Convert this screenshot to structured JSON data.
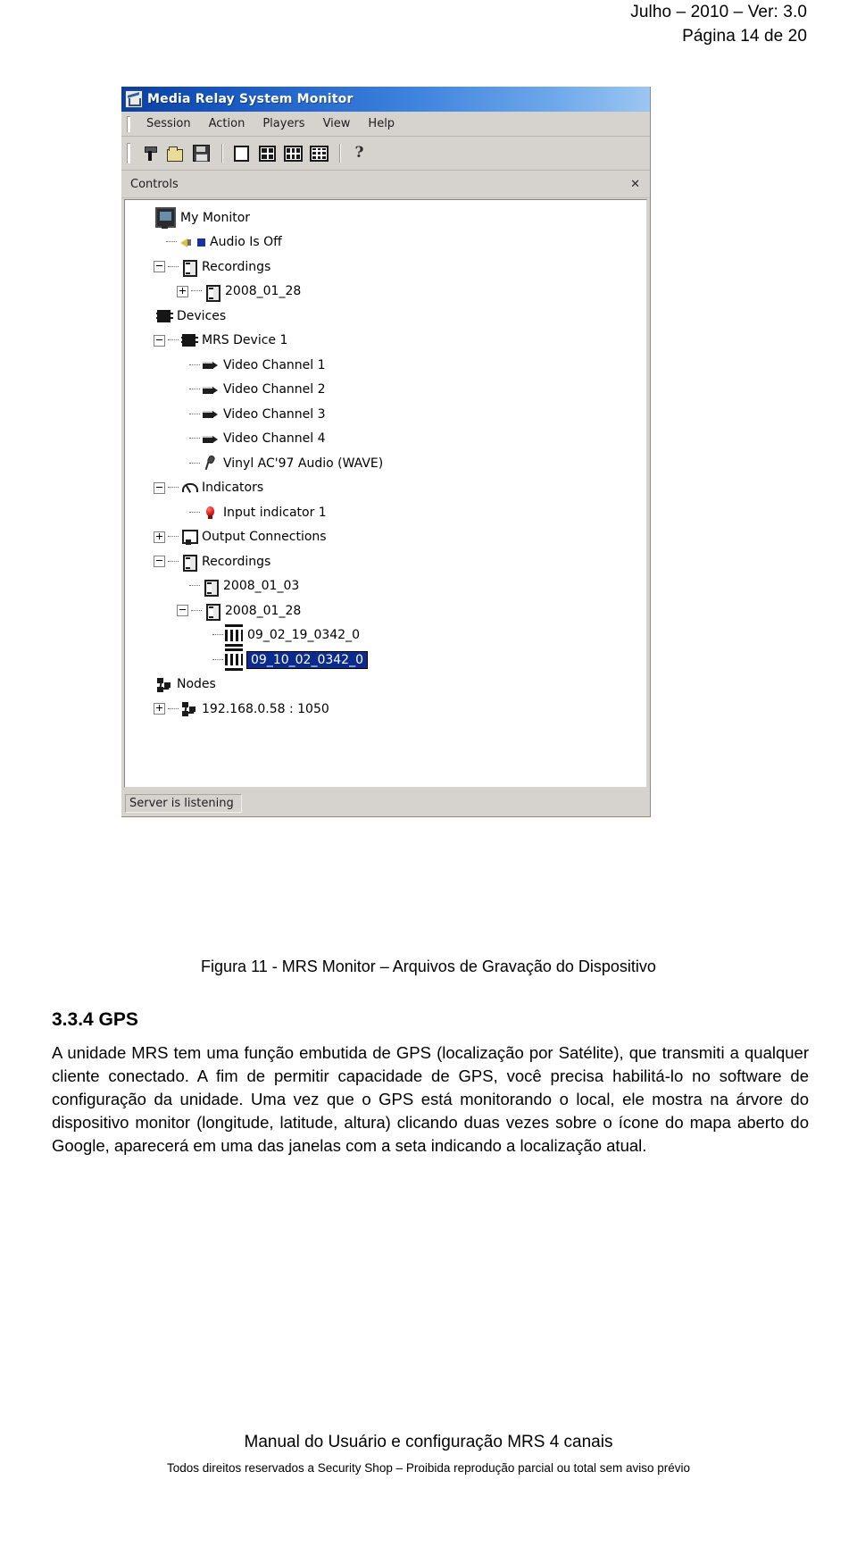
{
  "page_header": {
    "line1": "Julho – 2010 – Ver: 3.0",
    "line2": "Página 14 de 20"
  },
  "app_window": {
    "title": "Media Relay System Monitor",
    "title_icon": "app-logo-icon",
    "menu": [
      {
        "label": "Session"
      },
      {
        "label": "Action"
      },
      {
        "label": "Players"
      },
      {
        "label": "View"
      },
      {
        "label": "Help"
      }
    ],
    "toolbar": [
      {
        "icon": "connect-icon",
        "name": "new-session-button"
      },
      {
        "icon": "open-folder-icon",
        "name": "open-button"
      },
      {
        "icon": "save-floppy-icon",
        "name": "save-button"
      },
      {
        "icon": "separator",
        "name": "toolbar-separator-1"
      },
      {
        "icon": "layout-1x1-icon",
        "name": "layout-single-button"
      },
      {
        "icon": "layout-2x2-icon",
        "name": "layout-quad-button"
      },
      {
        "icon": "layout-2x3-icon",
        "name": "layout-six-button"
      },
      {
        "icon": "layout-3x3-icon",
        "name": "layout-nine-button"
      },
      {
        "icon": "separator",
        "name": "toolbar-separator-2"
      },
      {
        "icon": "help-question-icon",
        "name": "help-button"
      }
    ],
    "panel": {
      "caption": "Controls",
      "close_label": "✕"
    },
    "tree": [
      {
        "label": "My Monitor",
        "icon": "monitor-icon",
        "indent": 0,
        "expander": "none",
        "selected": false
      },
      {
        "label": "Audio Is Off",
        "icon": "speaker-icon",
        "indent": 1,
        "expander": "none",
        "selected": false,
        "badge": "blue-square"
      },
      {
        "label": "Recordings",
        "icon": "recordings-icon",
        "indent": 1,
        "expander": "minus",
        "selected": false
      },
      {
        "label": "2008_01_28",
        "icon": "recording-day-icon",
        "indent": 2,
        "expander": "plus",
        "selected": false
      },
      {
        "label": "Devices",
        "icon": "chip-icon",
        "indent": 0,
        "expander": "none",
        "selected": false
      },
      {
        "label": "MRS Device 1",
        "icon": "chip-icon",
        "indent": 1,
        "expander": "minus",
        "selected": false
      },
      {
        "label": "Video Channel 1",
        "icon": "camera-icon",
        "indent": 2,
        "expander": "none",
        "selected": false
      },
      {
        "label": "Video Channel 2",
        "icon": "camera-icon",
        "indent": 2,
        "expander": "none",
        "selected": false
      },
      {
        "label": "Video Channel 3",
        "icon": "camera-icon",
        "indent": 2,
        "expander": "none",
        "selected": false
      },
      {
        "label": "Video Channel 4",
        "icon": "camera-icon",
        "indent": 2,
        "expander": "none",
        "selected": false
      },
      {
        "label": "Vinyl AC'97 Audio (WAVE)",
        "icon": "microphone-icon",
        "indent": 2,
        "expander": "none",
        "selected": false
      },
      {
        "label": "Indicators",
        "icon": "gauge-icon",
        "indent": 1,
        "expander": "minus",
        "selected": false
      },
      {
        "label": "Input indicator 1",
        "icon": "led-indicator-icon",
        "indent": 2,
        "expander": "none",
        "selected": false
      },
      {
        "label": "Output Connections",
        "icon": "output-icon",
        "indent": 1,
        "expander": "plus",
        "selected": false
      },
      {
        "label": "Recordings",
        "icon": "recordings-icon",
        "indent": 1,
        "expander": "minus",
        "selected": false
      },
      {
        "label": "2008_01_03",
        "icon": "recording-day-icon",
        "indent": 2,
        "expander": "none",
        "selected": false
      },
      {
        "label": "2008_01_28",
        "icon": "recording-day-icon",
        "indent": 2,
        "expander": "minus",
        "selected": false
      },
      {
        "label": "09_02_19_0342_0",
        "icon": "film-strip-icon",
        "indent": 3,
        "expander": "none",
        "selected": false
      },
      {
        "label": "09_10_02_0342_0",
        "icon": "film-strip-icon",
        "indent": 3,
        "expander": "none",
        "selected": true
      },
      {
        "label": "Nodes",
        "icon": "network-node-icon",
        "indent": 0,
        "expander": "none",
        "selected": false
      },
      {
        "label": "192.168.0.58 : 1050",
        "icon": "network-node-icon",
        "indent": 1,
        "expander": "plus",
        "selected": false
      }
    ],
    "statusbar": {
      "text": "Server is listening"
    },
    "colors": {
      "selection": "#0b2c8c",
      "titlebar_start": "#0b3fa0",
      "titlebar_end": "#9cc6f2",
      "chrome": "#d6d3ce",
      "led_red": "#d81414"
    }
  },
  "figure_caption": "Figura 11 - MRS Monitor – Arquivos de Gravação do Dispositivo",
  "section": {
    "heading": "3.3.4 GPS",
    "body": "A unidade MRS tem uma função embutida de GPS (localização por Satélite), que transmiti a qualquer cliente conectado. A fim de permitir capacidade de GPS, você precisa habilitá-lo no software de configuração da unidade. Uma vez que o GPS está monitorando o local, ele mostra na árvore do dispositivo monitor (longitude, latitude, altura) clicando duas vezes sobre o ícone do mapa aberto do Google, aparecerá em uma das janelas com a seta indicando a localização atual."
  },
  "footer": {
    "line1": "Manual do Usuário e configuração MRS 4 canais",
    "line2": "Todos direitos reservados a Security Shop – Proibida reprodução parcial ou total sem aviso prévio"
  }
}
